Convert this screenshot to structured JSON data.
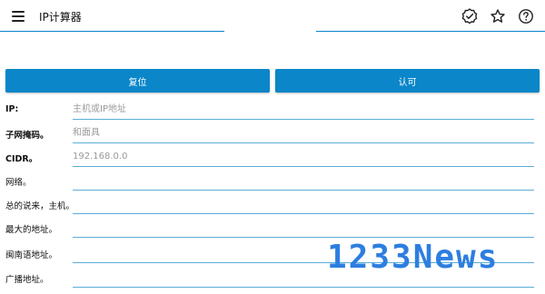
{
  "app_bar": {
    "title": "IP计算器",
    "icons": [
      "menu-icon",
      "verified-badge-icon",
      "star-icon",
      "help-icon"
    ]
  },
  "buttons": {
    "reset_label": "复位",
    "confirm_label": "认可"
  },
  "form": {
    "rows": [
      {
        "label": "IP:",
        "placeholder": "主机或IP地址",
        "value": ""
      },
      {
        "label": "子网掩码。",
        "placeholder": "和面具",
        "value": ""
      },
      {
        "label": "CIDR。",
        "placeholder": "192.168.0.0",
        "value": ""
      },
      {
        "label": "网络。",
        "placeholder": "",
        "value": ""
      },
      {
        "label": "总的说来，主机。",
        "placeholder": "",
        "value": ""
      },
      {
        "label": "最大的地址。",
        "placeholder": "",
        "value": ""
      },
      {
        "label": "闽南语地址。",
        "placeholder": "",
        "value": ""
      },
      {
        "label": "广播地址。",
        "placeholder": "",
        "value": ""
      }
    ]
  },
  "watermark": {
    "text": "1233News"
  },
  "colors": {
    "accent": "#0a86c9",
    "underline": "#5aaed8",
    "watermark": "#2d7ee0"
  }
}
